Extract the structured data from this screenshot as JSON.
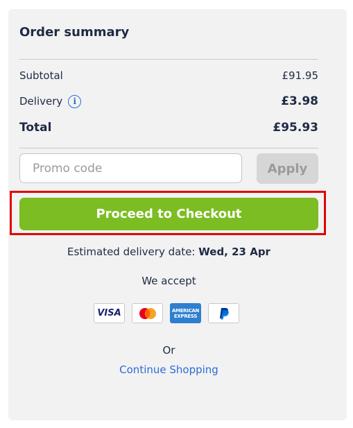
{
  "summary": {
    "title": "Order summary",
    "subtotal_label": "Subtotal",
    "subtotal_value": "£91.95",
    "delivery_label": "Delivery",
    "delivery_value": "£3.98",
    "total_label": "Total",
    "total_value": "£95.93"
  },
  "promo": {
    "placeholder": "Promo code",
    "value": "",
    "apply_label": "Apply"
  },
  "checkout": {
    "button_label": "Proceed to Checkout",
    "highlight_color": "#e00000",
    "button_color": "#7bbd22"
  },
  "delivery_estimate": {
    "label": "Estimated delivery date:",
    "date": "Wed, 23 Apr"
  },
  "payments": {
    "heading": "We accept",
    "methods": [
      "visa-icon",
      "mastercard-icon",
      "american-express-icon",
      "paypal-icon"
    ],
    "visa_text": "VISA",
    "amex_text": "AMERICAN EXPRESS"
  },
  "footer": {
    "or_text": "Or",
    "continue_label": "Continue Shopping"
  }
}
